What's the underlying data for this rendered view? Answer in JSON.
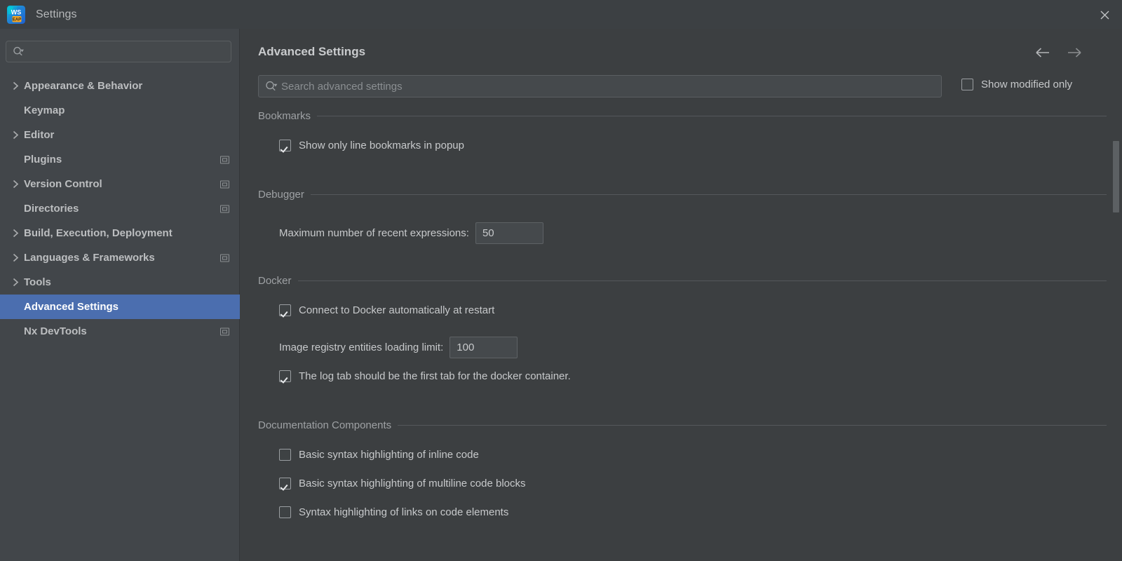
{
  "window": {
    "title": "Settings",
    "app_icon": "webstorm-eap-icon",
    "close_icon": "close-icon",
    "accent_selection": "#4b6eaf",
    "background": "#3c3f41",
    "sidebar_background": "#42464a"
  },
  "sidebar": {
    "search": {
      "value": "",
      "placeholder": "",
      "icon": "search-icon"
    },
    "items": [
      {
        "label": "Appearance & Behavior",
        "expandable": true,
        "badge": false,
        "selected": false
      },
      {
        "label": "Keymap",
        "expandable": false,
        "badge": false,
        "selected": false
      },
      {
        "label": "Editor",
        "expandable": true,
        "badge": false,
        "selected": false
      },
      {
        "label": "Plugins",
        "expandable": false,
        "badge": true,
        "selected": false
      },
      {
        "label": "Version Control",
        "expandable": true,
        "badge": true,
        "selected": false
      },
      {
        "label": "Directories",
        "expandable": false,
        "badge": true,
        "selected": false
      },
      {
        "label": "Build, Execution, Deployment",
        "expandable": true,
        "badge": false,
        "selected": false
      },
      {
        "label": "Languages & Frameworks",
        "expandable": true,
        "badge": true,
        "selected": false
      },
      {
        "label": "Tools",
        "expandable": true,
        "badge": false,
        "selected": false
      },
      {
        "label": "Advanced Settings",
        "expandable": false,
        "badge": false,
        "selected": true
      },
      {
        "label": "Nx DevTools",
        "expandable": false,
        "badge": true,
        "selected": false
      }
    ]
  },
  "main": {
    "title": "Advanced Settings",
    "back_icon": "arrow-left-icon",
    "forward_icon": "arrow-right-icon",
    "search": {
      "value": "",
      "placeholder": "Search advanced settings",
      "icon": "search-icon"
    },
    "show_modified_only": {
      "label": "Show modified only",
      "checked": false
    },
    "sections": [
      {
        "title": "Bookmarks",
        "options": [
          {
            "type": "checkbox",
            "label": "Show only line bookmarks in popup",
            "checked": true
          }
        ]
      },
      {
        "title": "Debugger",
        "options": [
          {
            "type": "spinner",
            "label": "Maximum number of recent expressions:",
            "value": "50"
          }
        ]
      },
      {
        "title": "Docker",
        "options": [
          {
            "type": "checkbox",
            "label": "Connect to Docker automatically at restart",
            "checked": true
          },
          {
            "type": "spinner",
            "label": "Image registry entities loading limit:",
            "value": "100"
          },
          {
            "type": "checkbox",
            "label": "The log tab should be the first tab for the docker container.",
            "checked": true
          }
        ]
      },
      {
        "title": "Documentation Components",
        "options": [
          {
            "type": "checkbox",
            "label": "Basic syntax highlighting of inline code",
            "checked": false
          },
          {
            "type": "checkbox",
            "label": "Basic syntax highlighting of multiline code blocks",
            "checked": true
          },
          {
            "type": "checkbox",
            "label": "Syntax highlighting of links on code elements",
            "checked": false
          }
        ]
      }
    ]
  }
}
